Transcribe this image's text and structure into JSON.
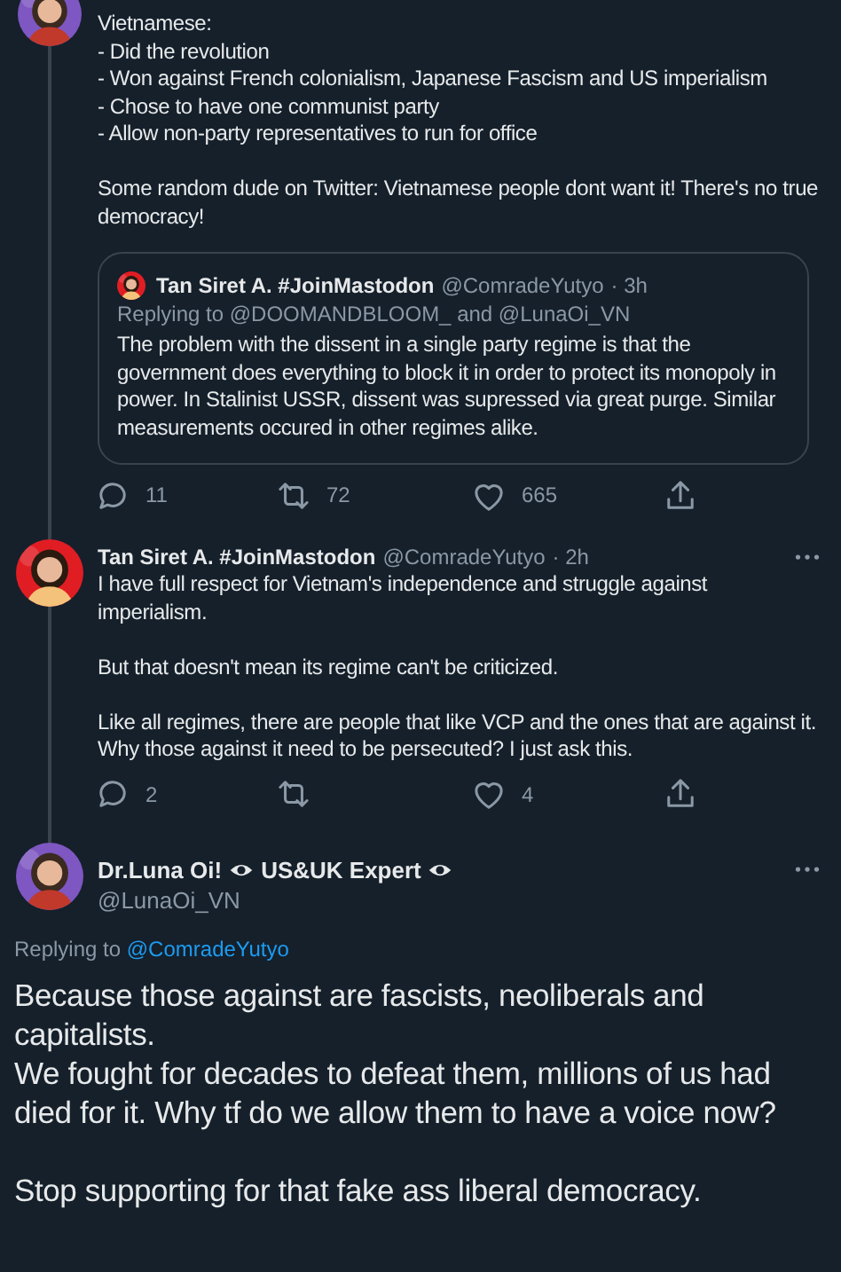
{
  "thread": [
    {
      "body": "Vietnamese:\n- Did the revolution\n- Won against French colonialism, Japanese Fascism and US imperialism\n- Chose to have one communist party\n- Allow non-party representatives to run for office\n\nSome random dude on Twitter: Vietnamese people dont want it! There's no true democracy!",
      "quote": {
        "name": "Tan Siret A. #JoinMastodon",
        "handle": "@ComradeYutyo",
        "time": "· 3h",
        "replying": "Replying to @DOOMANDBLOOM_ and @LunaOi_VN",
        "body": "The problem with the dissent in a single party regime is that the government does everything to block it in order to protect its monopoly in power. In Stalinist USSR, dissent was supressed via great purge. Similar measurements occured in other regimes alike."
      },
      "actions": {
        "replies": "11",
        "retweets": "72",
        "likes": "665"
      }
    },
    {
      "author": {
        "name": "Tan Siret A. #JoinMastodon",
        "handle": "@ComradeYutyo",
        "time": "· 2h"
      },
      "body": "I have full respect for Vietnam's independence and struggle against imperialism.\n\nBut that doesn't mean its regime can't be criticized.\n\nLike all regimes, there are people that like VCP and the ones that are against it. Why those against it need to be persecuted? I just ask this.",
      "actions": {
        "replies": "2",
        "likes": "4"
      }
    }
  ],
  "focused": {
    "name": "Dr.Luna Oi!",
    "name_suffix": "US&UK Expert",
    "handle": "@LunaOi_VN",
    "replying_prefix": "Replying to",
    "replying_link": "@ComradeYutyo",
    "body": "Because those against are fascists, neoliberals and capitalists.\nWe fought for decades to defeat them, millions of us had died for it. Why tf do we allow them to have a voice now?\n\nStop supporting for that fake ass liberal democracy."
  }
}
